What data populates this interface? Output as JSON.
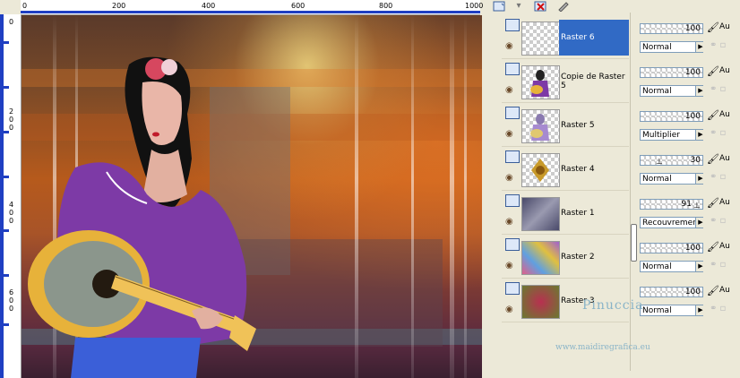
{
  "ruler": {
    "top_labels": [
      "0",
      "200",
      "400",
      "600",
      "800",
      "1000"
    ],
    "left_labels": [
      "0",
      "2 0 0",
      "4 0 0",
      "6 0 0"
    ]
  },
  "toolbar": {
    "icons": [
      "layer-icon",
      "delete-icon",
      "edit-icon"
    ]
  },
  "layers": [
    {
      "name": "Raster 6",
      "selected": true,
      "thumb": "checker",
      "opacity": "100",
      "blend": "Normal"
    },
    {
      "name": "Copie de Raster 5",
      "selected": false,
      "thumb": "woman",
      "opacity": "100",
      "blend": "Normal"
    },
    {
      "name": "Raster 5",
      "selected": false,
      "thumb": "woman-faint",
      "opacity": "100",
      "blend": "Multiplier"
    },
    {
      "name": "Raster 4",
      "selected": false,
      "thumb": "ornament",
      "opacity": "30",
      "blend": "Normal"
    },
    {
      "name": "Raster 1",
      "selected": false,
      "thumb": "bluegray",
      "opacity": "91",
      "blend": "Recouvrement"
    },
    {
      "name": "Raster 2",
      "selected": false,
      "thumb": "colorful",
      "opacity": "100",
      "blend": "Normal"
    },
    {
      "name": "Raster 3",
      "selected": false,
      "thumb": "greenred",
      "opacity": "100",
      "blend": "Normal"
    }
  ],
  "props": {
    "au_label": "Au"
  },
  "watermark": {
    "title": "Pinuccia",
    "url": "www.maidiregrafica.eu"
  },
  "colors": {
    "selection": "#316ac5",
    "panel_bg": "#ece9d8",
    "watermark": "#8ab4c8"
  }
}
